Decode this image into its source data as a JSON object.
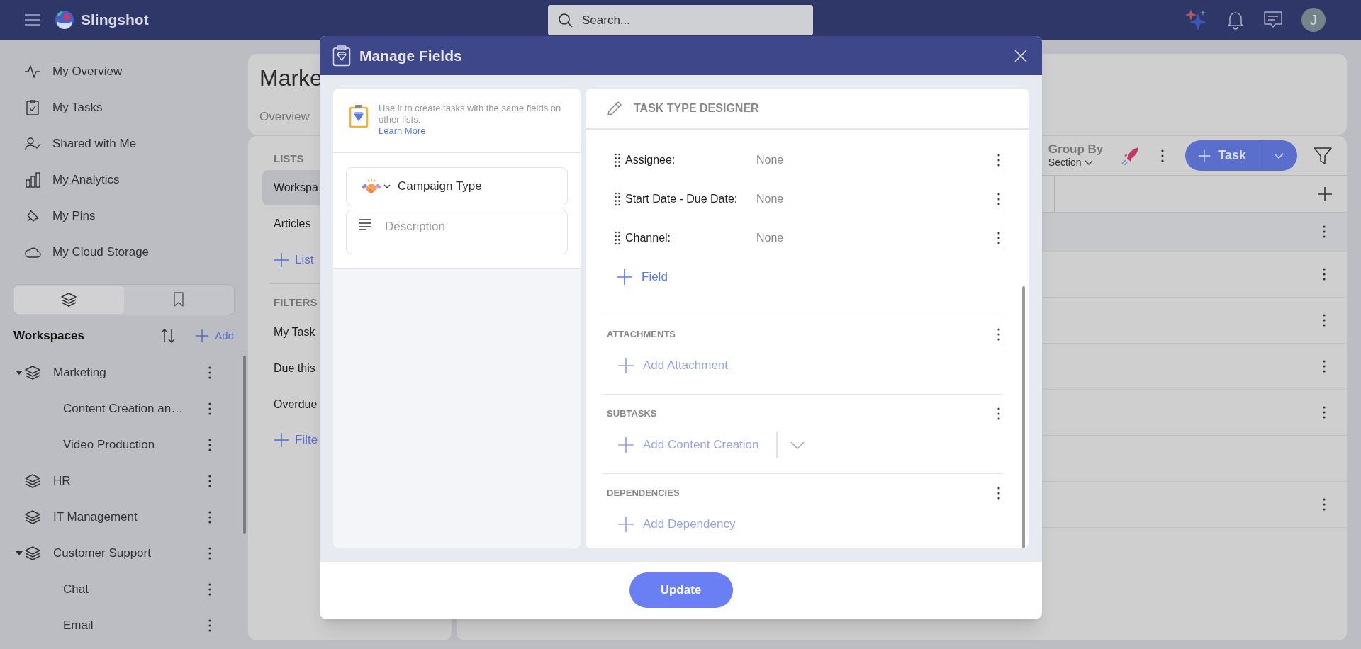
{
  "app_bar": {
    "brand": "Slingshot",
    "search": {
      "placeholder": "Search..."
    },
    "avatar": "J"
  },
  "sidebar": {
    "nav_items": [
      {
        "label": "My Overview",
        "kind": "overview"
      },
      {
        "label": "My Tasks",
        "kind": "tasks"
      },
      {
        "label": "Shared with Me",
        "kind": "shared"
      },
      {
        "label": "My Analytics",
        "kind": "analytics"
      },
      {
        "label": "My Pins",
        "kind": "pins"
      },
      {
        "label": "My Cloud Storage",
        "kind": "storage"
      }
    ],
    "view_tabs": [
      {
        "kind": "layers",
        "selected": true
      },
      {
        "kind": "bookmark",
        "selected": false
      }
    ],
    "workspaces": {
      "title": "Workspaces",
      "add_label": "Add",
      "items": [
        {
          "label": "Marketing",
          "children": [
            {
              "label": "Content Creation an…"
            },
            {
              "label": "Video Production"
            }
          ]
        },
        {
          "label": "HR"
        },
        {
          "label": "IT Management"
        },
        {
          "label": "Customer Support",
          "children": [
            {
              "label": "Chat"
            },
            {
              "label": "Email"
            }
          ]
        }
      ]
    }
  },
  "page": {
    "title": "Marke",
    "tabs": [
      {
        "label": "Overview"
      }
    ],
    "lists": {
      "title": "LISTS",
      "items": [
        {
          "label": "Workspa",
          "selected": true
        },
        {
          "label": "Articles",
          "selected": false
        }
      ],
      "add_label": "List"
    },
    "filters": {
      "title": "FILTERS",
      "items": [
        {
          "label": "My Task"
        },
        {
          "label": "Due this"
        },
        {
          "label": "Overdue"
        }
      ],
      "add_label": "Filte"
    },
    "board": {
      "group_by": {
        "label": "Group By",
        "value": "Section"
      },
      "new_button": "Task",
      "rows": [
        {
          "menu": true
        },
        {
          "menu": true
        },
        {
          "menu": true
        },
        {
          "menu": true
        },
        {
          "menu": true
        },
        {
          "menu": false
        },
        {
          "menu": true
        }
      ]
    }
  },
  "modal": {
    "title": "Manage Fields",
    "info": {
      "text": "Use it to create tasks with the same fields on other lists.",
      "link": "Learn More"
    },
    "name_field": {
      "value": "Campaign Type"
    },
    "description_field": {
      "placeholder": "Description"
    },
    "designer": {
      "title": "TASK TYPE DESIGNER",
      "fields": [
        {
          "label": "Assignee:",
          "value": "None"
        },
        {
          "label": "Start Date - Due Date:",
          "value": "None"
        },
        {
          "label": "Channel:",
          "value": "None"
        }
      ],
      "add_field": "Field",
      "sections": [
        {
          "title": "ATTACHMENTS",
          "action": "Add Attachment",
          "disabled": true,
          "dropdown": false
        },
        {
          "title": "SUBTASKS",
          "action": "Add Content Creation",
          "disabled": true,
          "dropdown": true
        },
        {
          "title": "DEPENDENCIES",
          "action": "Add Dependency",
          "disabled": true,
          "dropdown": false
        }
      ]
    },
    "footer_button": "Update"
  }
}
